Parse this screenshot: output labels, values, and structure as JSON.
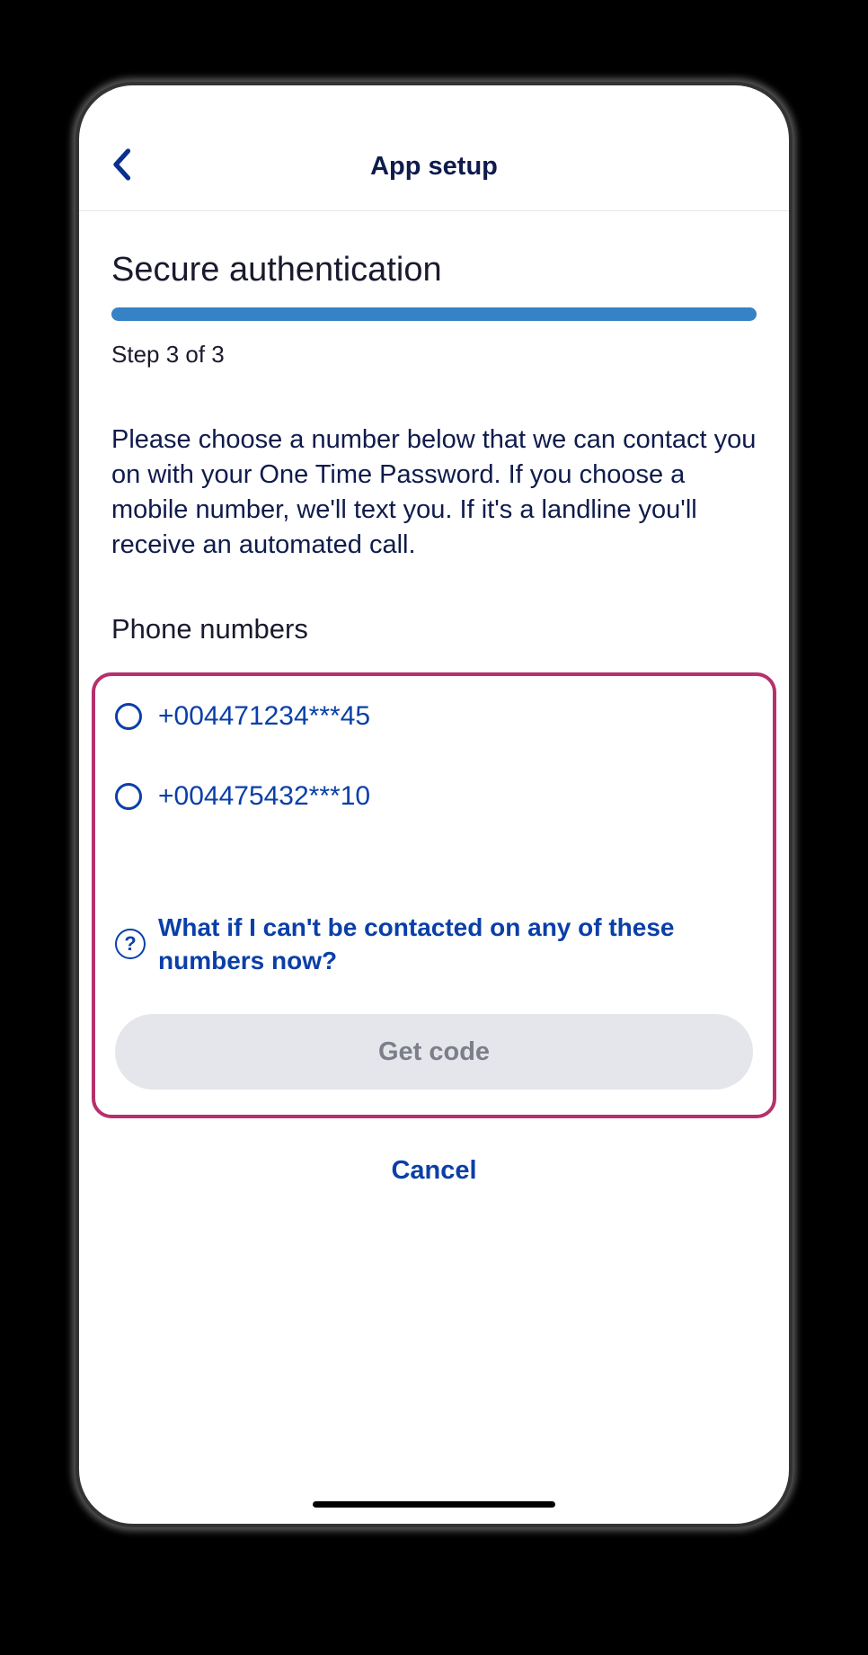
{
  "header": {
    "title": "App setup"
  },
  "page": {
    "title": "Secure authentication",
    "step_label": "Step 3 of 3",
    "instruction": "Please choose a number below that we can contact you on with your One Time Password. If you choose a mobile number, we'll text you. If it's a landline you'll receive an automated call.",
    "section_label": "Phone numbers"
  },
  "phone_options": [
    {
      "label": "+004471234***45"
    },
    {
      "label": "+004475432***10"
    }
  ],
  "help": {
    "text": "What if I can't be contacted on any of these numbers now?"
  },
  "buttons": {
    "get_code": "Get code",
    "cancel": "Cancel"
  }
}
